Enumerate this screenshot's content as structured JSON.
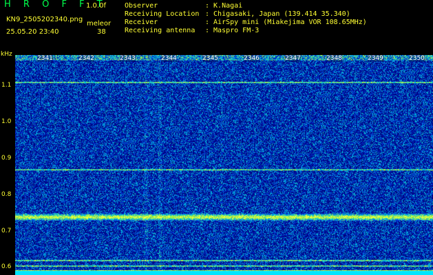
{
  "header": {
    "title": "H R O F F T",
    "version": "1.0.0f",
    "filename": "KN9_2505202340.png",
    "station_name": "meleor",
    "datetime": "25.05.20 23:40",
    "count": "38"
  },
  "info": [
    {
      "label": "Observer",
      "value": ": K.Nagai"
    },
    {
      "label": "Receiving Location",
      "value": ": Chigasaki, Japan (139.414 35.340)"
    },
    {
      "label": "Receiver",
      "value": ": AirSpy mini (Miakejima VOR 108.65MHz)"
    },
    {
      "label": "Receiving antenna",
      "value": ": Maspro FM-3"
    }
  ],
  "chart_data": {
    "type": "heatmap",
    "ylabel": "kHz",
    "yticks": [
      "1.1",
      "1.0",
      "0.9",
      "0.8",
      "0.7",
      "0.6"
    ],
    "ytick_values": [
      1.1,
      1.0,
      0.9,
      0.8,
      0.7,
      0.6
    ],
    "ylim": [
      0.58,
      1.185
    ],
    "time_labels": [
      "2341",
      "2342",
      "2343",
      "2344",
      "2345",
      "2346",
      "2347",
      "2348",
      "2349",
      "2350"
    ],
    "carrier_lines_khz": [
      1.11,
      0.87,
      0.74,
      0.62,
      0.605
    ]
  },
  "colors": {
    "label_yellow": "#ffff33",
    "title_green": "#00ff4c",
    "background_blue": "#001088"
  }
}
